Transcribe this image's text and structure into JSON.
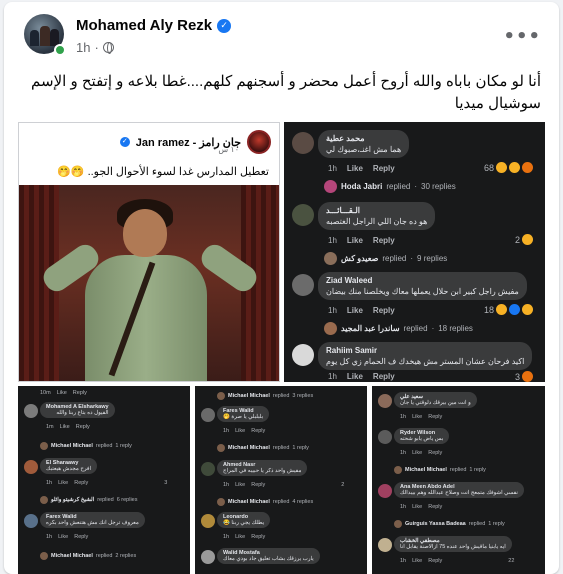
{
  "post": {
    "author": "Mohamed Aly Rezk",
    "time": "1h",
    "privacy_separator": "·",
    "more_label": "•••",
    "verified_glyph": "✓",
    "caption": "أنا لو مكان باباه والله أروح أعمل محضر و أسجنهم كلهم....غطا بلاعه و إتفتح و الإسم سوشيال ميديا"
  },
  "shared_post": {
    "author": "جان رامز - Jan ramez",
    "time": "١٠ س ·",
    "text": "تعطيل المدارس غدا لسوء الأحوال الجو.. 🤭🤭"
  },
  "comments": [
    {
      "name": "محمد عطية",
      "text": "هما مش اغنـ،صبوك لي",
      "like": "Like",
      "reply": "Reply",
      "time": "1h",
      "reactions": "68",
      "replied_by": "Hoda Jabri",
      "replied_label": "replied",
      "replies": "30 replies"
    },
    {
      "name": "الـقـــائـــد",
      "text": "هو ده جان اللي الراجل الغتصبه",
      "like": "Like",
      "reply": "Reply",
      "time": "1h",
      "reactions": "2",
      "replied_by": "صعيدو كش",
      "replied_label": "replied",
      "replies": "9 replies"
    },
    {
      "name": "Ziad Waleed",
      "text": "مفيش راجل كبير ابن حلال يعملها معاك ويخلصنا منك بيضان",
      "like": "Like",
      "reply": "Reply",
      "time": "1h",
      "reactions": "18",
      "replied_by": "ساندرا عبد المجيد",
      "replied_label": "replied",
      "replies": "18 replies"
    },
    {
      "name": "Rahiim Samir",
      "text": "اكيد فرحان عشان المستر مش هيخدك ف الحمام زي كل يوم",
      "like": "Like",
      "reply": "Reply",
      "time": "1h",
      "reactions": "3"
    }
  ],
  "thumb1": [
    {
      "time": "10m",
      "like": "Like",
      "reply": "Reply"
    },
    {
      "name": "Mohamed A Elsharkawy",
      "text": "الفيول ده بتاع ربنا والله",
      "time": "1m",
      "like": "Like",
      "reply": "Reply"
    },
    {
      "replied_by": "Michael Michael",
      "replied_label": "replied",
      "replies": "1 reply"
    },
    {
      "name": "El Sharaawy",
      "text": "افرح مجدش هيعتبك",
      "time": "1h",
      "like": "Like",
      "reply": "Reply",
      "reactions": "3"
    },
    {
      "replied_by": "الشيخ كرشيتو وائلو",
      "replied_label": "replied",
      "replies": "6 replies"
    },
    {
      "name": "Farex Walid",
      "text": "معروف ترجل انك مش هتنعش واحد بكره",
      "time": "1h",
      "like": "Like",
      "reply": "Reply"
    },
    {
      "replied_by": "Michael Michael",
      "replied_label": "replied",
      "replies": "2 replies"
    }
  ],
  "thumb2": [
    {
      "replied_by": "Michael Michael",
      "replied_label": "replied",
      "replies": "3 replies"
    },
    {
      "name": "Fares Walid",
      "text": "بلبلبلي يا صرة 🤭",
      "time": "1h",
      "like": "Like",
      "reply": "Reply"
    },
    {
      "replied_by": "Michael Michael",
      "replied_label": "replied",
      "replies": "1 reply"
    },
    {
      "name": "Ahmed Nasr",
      "text": "مفيش واحد ذكر يا حبيبه في المراج",
      "time": "1h",
      "like": "Like",
      "reply": "Reply",
      "reactions": "2"
    },
    {
      "replied_by": "Michael Michael",
      "replied_label": "replied",
      "replies": "4 replies"
    },
    {
      "name": "Leonardo",
      "text": "يطلك يجي ربنا 😂",
      "time": "1h",
      "like": "Like",
      "reply": "Reply"
    },
    {
      "name": "Walid Mostafa",
      "text": "يارب يرزقك بشاب تعليق جاد بودي معاك",
      "time": "",
      "like": "",
      "reply": ""
    }
  ],
  "thumb3": [
    {
      "name": "سعيد علي",
      "text": "و انت مين بيرقك دلوقتي يا جان",
      "time": "1h",
      "like": "Like",
      "reply": "Reply"
    },
    {
      "name": "Ryder Wilson",
      "text": "بس ياض يابو شحته",
      "time": "1h",
      "like": "Like",
      "reply": "Reply"
    },
    {
      "replied_by": "Michael Michael",
      "replied_label": "replied",
      "replies": "1 reply"
    },
    {
      "name": "Ana Meen Abdo Adel",
      "text": "نفسي اشوفك متمعج انت وصلاح عبدالله وهم بيبدالك",
      "time": "1h",
      "like": "Like",
      "reply": "Reply"
    },
    {
      "replied_by": "Guirguis Yassa Badeaa",
      "replied_label": "replied",
      "replies": "1 reply"
    },
    {
      "name": "مصطفي الخشاب",
      "text": "ايه يابنيا ماقيش واحد عنده 75 ازالاصنة يقابل انا",
      "time": "1h",
      "like": "Like",
      "reply": "Reply",
      "reactions": "22"
    }
  ],
  "colors": {
    "accent": "#1877f2",
    "online": "#31a24c",
    "dark_bg": "#18191a",
    "bubble": "#3a3b3c"
  },
  "icons": {
    "verified": "verified-badge-icon",
    "privacy": "globe-icon",
    "more": "more-options-icon"
  }
}
